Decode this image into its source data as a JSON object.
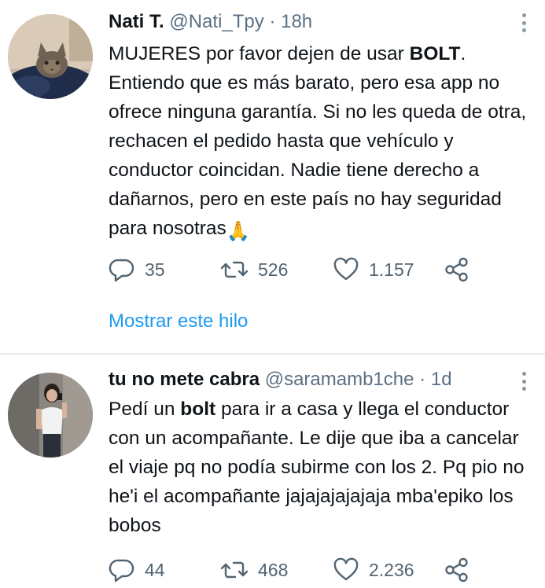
{
  "tweets": [
    {
      "display_name": "Nati T.",
      "handle": "@Nati_Tpy",
      "separator": "·",
      "time": "18h",
      "text_parts": {
        "p1": "MUJERES por favor dejen de usar ",
        "p1_bold": "BOLT",
        "p2": ". Entiendo que es más barato, pero esa app no ofrece ninguna garantía. Si no les queda de otra, rechacen el pedido hasta que vehículo y conductor coincidan. Nadie tiene derecho a dañarnos, pero en este país no hay seguridad para nosotras",
        "emoji": "🙏"
      },
      "replies": "35",
      "retweets": "526",
      "likes": "1.157",
      "thread_link": "Mostrar este hilo",
      "icons": [
        "reply-icon",
        "retweet-icon",
        "like-icon",
        "share-icon",
        "more-icon"
      ]
    },
    {
      "display_name": "tu no mete cabra",
      "handle": "@saramamb1che",
      "separator": "·",
      "time": "1d",
      "text_parts": {
        "p1": "Pedí un ",
        "p1_bold": "bolt",
        "p2": " para ir a casa y llega el conductor con un acompañante. Le dije que iba a cancelar el viaje pq no podía subirme con los 2. Pq pio no he'i el acompañante jajajajajajaja mba'epiko los bobos"
      },
      "replies": "44",
      "retweets": "468",
      "likes": "2.236",
      "icons": [
        "reply-icon",
        "retweet-icon",
        "like-icon",
        "share-icon",
        "more-icon"
      ]
    }
  ],
  "colors": {
    "text": "#0f1419",
    "secondary": "#5b7083",
    "link": "#1d9bf0",
    "divider": "#e6e9eb"
  }
}
